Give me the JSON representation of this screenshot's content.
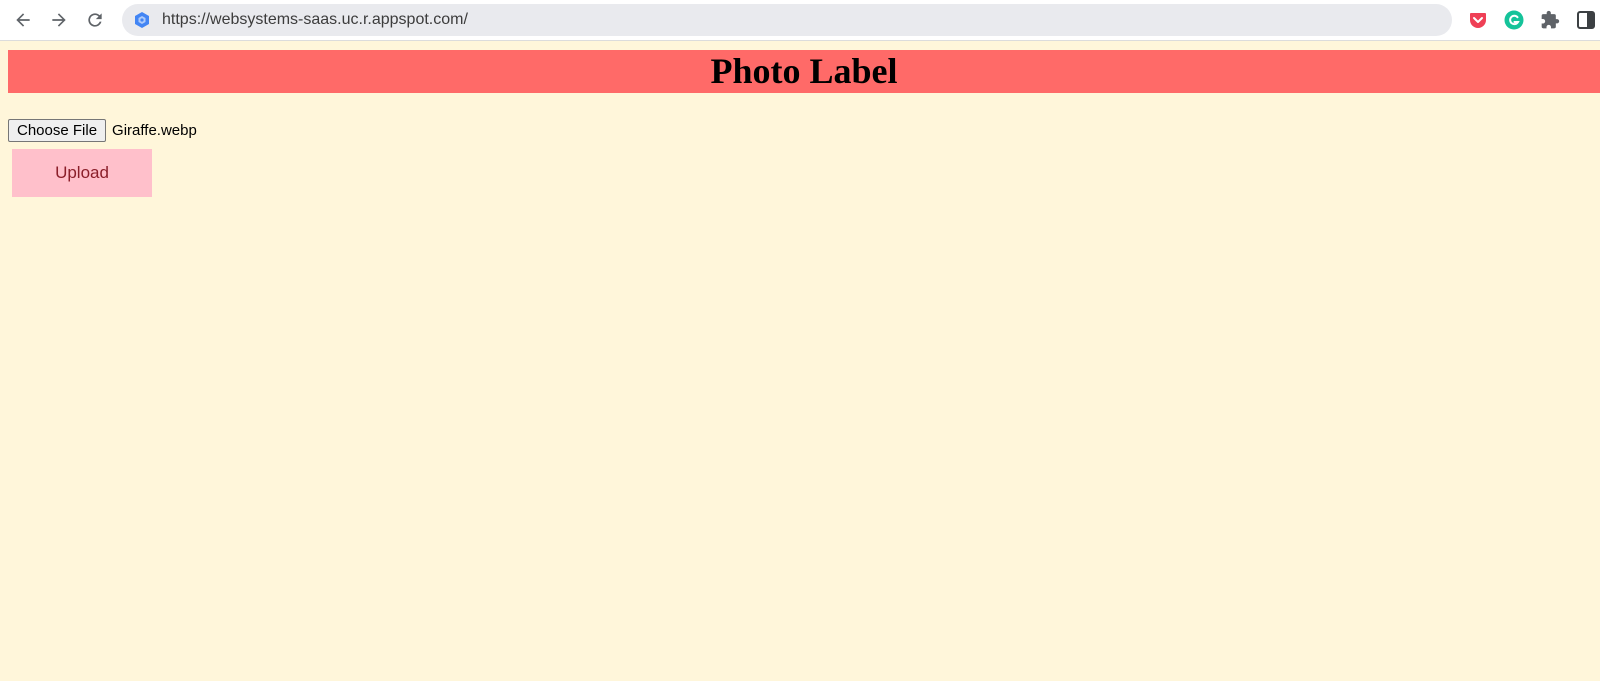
{
  "browser": {
    "url": "https://websystems-saas.uc.r.appspot.com/",
    "nav_icons": [
      "back-arrow-icon",
      "forward-arrow-icon",
      "reload-icon"
    ],
    "extension_icons": [
      "pocket-icon",
      "grammarly-icon",
      "extensions-puzzle-icon",
      "side-panel-icon"
    ]
  },
  "page": {
    "title": "Photo Label",
    "choose_file_label": "Choose File",
    "selected_file": "Giraffe.webp",
    "upload_label": "Upload"
  },
  "colors": {
    "page_background": "#fff6da",
    "banner_background": "#ff6a68",
    "upload_background": "#ffc0cb",
    "upload_text": "#8b1f2a"
  }
}
